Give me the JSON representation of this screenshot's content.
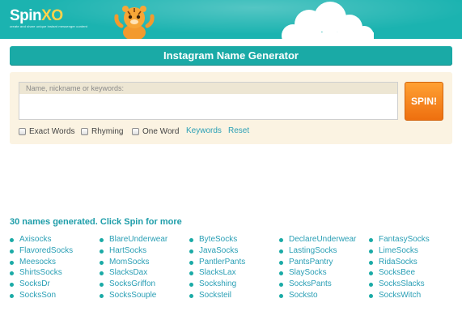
{
  "header": {
    "logo_primary": "Spin",
    "logo_accent": "XO",
    "tagline": "create and share unique instant messenger content",
    "colors": {
      "header_bg": "#1bb3b0",
      "logo_accent": "#ffd24a"
    }
  },
  "title": "Instagram Name Generator",
  "form": {
    "input_label": "Name, nickname or keywords:",
    "input_value": "",
    "spin_label": "SPIN!",
    "options": [
      {
        "label": "Exact Words",
        "checked": false
      },
      {
        "label": "Rhyming",
        "checked": false
      },
      {
        "label": "One Word",
        "checked": false
      }
    ],
    "links": {
      "keywords": "Keywords",
      "reset": "Reset"
    }
  },
  "results": {
    "title": "30 names generated. Click Spin for more",
    "columns": [
      [
        "Axisocks",
        "FlavoredSocks",
        "Meesocks",
        "ShirtsSocks",
        "SocksDr",
        "SocksSon"
      ],
      [
        "BlareUnderwear",
        "HartSocks",
        "MomSocks",
        "SlacksDax",
        "SocksGriffon",
        "SocksSouple"
      ],
      [
        "ByteSocks",
        "JavaSocks",
        "PantlerPants",
        "SlacksLax",
        "Sockshing",
        "Socksteil"
      ],
      [
        "DeclareUnderwear",
        "LastingSocks",
        "PantsPantry",
        "SlaySocks",
        "SocksPants",
        "Socksto"
      ],
      [
        "FantasySocks",
        "LimeSocks",
        "RidaSocks",
        "SocksBee",
        "SocksSlacks",
        "SocksWitch"
      ]
    ]
  }
}
